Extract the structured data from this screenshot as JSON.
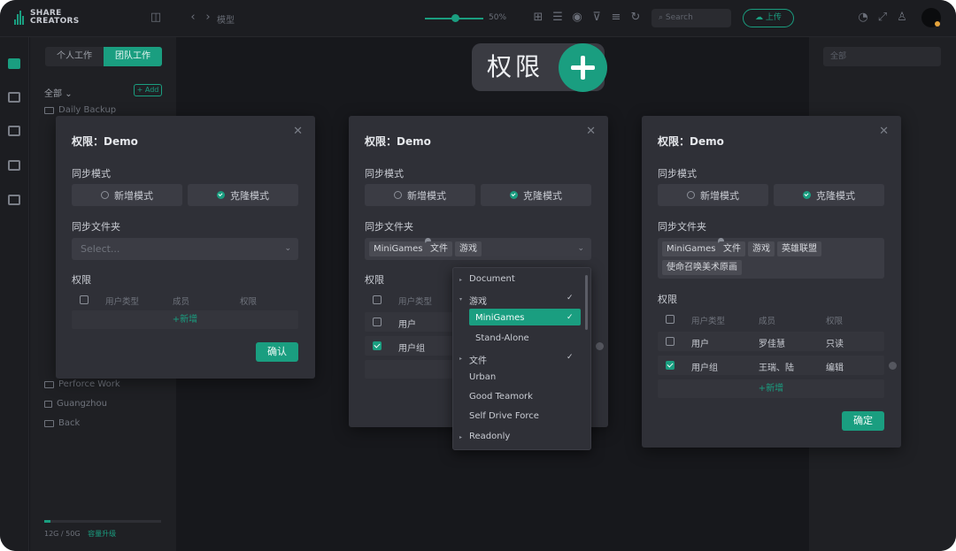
{
  "topbar": {
    "logo_line1": "SHARE",
    "logo_line2": "CREATORS",
    "breadcrumb": "模型",
    "zoom": "50%",
    "search_placeholder": "Search",
    "upload_label": "上传"
  },
  "sidebar": {
    "tab_personal": "个人工作",
    "tab_team": "团队工作",
    "filter_all": "全部",
    "add_label": "+ Add",
    "items": [
      {
        "label": "Daily Backup",
        "icon": "folder-icon"
      },
      {
        "label": "Perforce Work",
        "icon": "folder-icon"
      },
      {
        "label": "Guangzhou",
        "icon": "lock-icon"
      },
      {
        "label": "Back",
        "icon": "folder-icon"
      }
    ],
    "quota": "12G / 50G",
    "quota_upgrade": "容量升级",
    "quota_fraction": 0.05
  },
  "right_panel": {
    "input_placeholder": "全部"
  },
  "hero": {
    "text": "权限"
  },
  "dialog_common": {
    "title": "权限：Demo",
    "sync_mode_label": "同步模式",
    "mode_new": "新增模式",
    "mode_clone": "克隆模式",
    "sync_folder_label": "同步文件夹",
    "permission_label": "权限",
    "col_check": "",
    "col_user_type": "用户类型",
    "col_member": "成员",
    "col_permission": "权限",
    "add_row": "+新增"
  },
  "dialog1": {
    "select_placeholder": "Select...",
    "confirm": "确认"
  },
  "dialog2": {
    "tags": [
      "MiniGames",
      "文件",
      "游戏"
    ],
    "rows": [
      {
        "type": "用户",
        "checked": false
      },
      {
        "type": "用户组",
        "checked": true
      }
    ],
    "dropdown": [
      {
        "label": "Document",
        "level": 0,
        "arrow": "▸",
        "checked": false
      },
      {
        "label": "游戏",
        "level": 0,
        "arrow": "▾",
        "checked": true
      },
      {
        "label": "MiniGames",
        "level": 1,
        "selected": true,
        "checked": true
      },
      {
        "label": "Stand-Alone",
        "level": 1
      },
      {
        "label": "文件",
        "level": 0,
        "arrow": "▸",
        "checked": true
      },
      {
        "label": "Urban",
        "level": 0
      },
      {
        "label": "Good Teamork",
        "level": 0
      },
      {
        "label": "Self Drive Force",
        "level": 0
      },
      {
        "label": "Readonly",
        "level": 0,
        "arrow": "▸"
      }
    ]
  },
  "dialog3": {
    "tags_line1": [
      "MiniGames",
      "文件",
      "游戏",
      "英雄联盟"
    ],
    "tags_line2": [
      "使命召唤美术原画"
    ],
    "rows": [
      {
        "type": "用户",
        "member": "罗佳慧",
        "permission": "只读",
        "checked": false
      },
      {
        "type": "用户组",
        "member": "王瑞、陆",
        "permission": "编辑",
        "checked": true
      }
    ],
    "confirm": "确定"
  },
  "colors": {
    "accent": "#1a9e80",
    "background": "#17181c",
    "dialog": "#2f3037"
  }
}
